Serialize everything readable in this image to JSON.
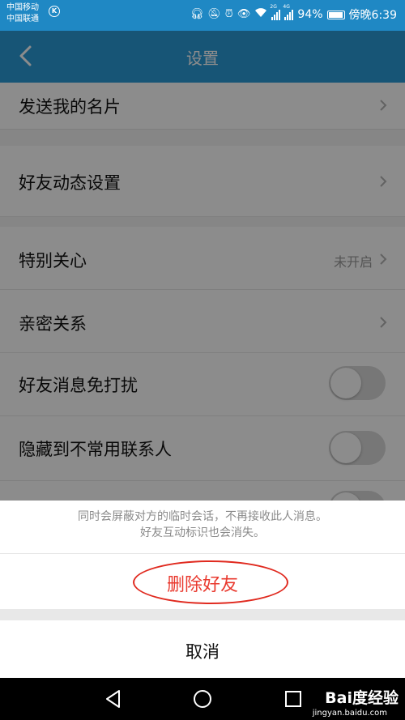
{
  "status_bar": {
    "carrier1": "中国移动",
    "carrier2": "中国联通",
    "k_badge": "K",
    "signal1_tag": "2G",
    "signal2_tag": "4G",
    "battery": "94%",
    "time": "傍晚6:39"
  },
  "nav": {
    "title": "设置"
  },
  "settings": {
    "items": [
      {
        "label": "发送我的名片"
      },
      {
        "label": "好友动态设置"
      },
      {
        "label": "特别关心",
        "value": "未开启"
      },
      {
        "label": "亲密关系"
      },
      {
        "label": "好友消息免打扰",
        "toggle_on": false
      },
      {
        "label": "隐藏到不常用联系人",
        "toggle_on": false
      }
    ]
  },
  "sheet": {
    "desc_line1": "同时会屏蔽对方的临时会话，不再接收此人消息。",
    "desc_line2": "好友互动标识也会消失。",
    "delete_label": "删除好友",
    "cancel_label": "取消"
  },
  "watermark": {
    "brand": "Bai度经验",
    "url": "jingyan.baidu.com"
  },
  "colors": {
    "status_bar": "#1f88c4",
    "nav_bar": "#2a9bd8",
    "danger": "#e93a2f",
    "annotation_circle": "#e02a1f"
  }
}
